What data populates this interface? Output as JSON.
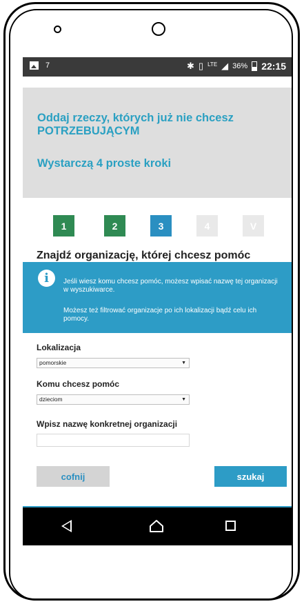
{
  "status_bar": {
    "notification_number": "7",
    "icons": [
      "image-icon",
      "bluetooth-icon",
      "vibrate-icon",
      "lte-icon",
      "signal-icon",
      "battery-icon"
    ],
    "lte_label": "LTE",
    "battery": "36%",
    "time": "22:15"
  },
  "hero": {
    "title": "Oddaj rzeczy, których już nie chcesz POTRZEBUJĄCYM",
    "subtitle": "Wystarczą 4 proste kroki"
  },
  "steps": [
    {
      "label": "1",
      "state": "done"
    },
    {
      "label": "2",
      "state": "done"
    },
    {
      "label": "3",
      "state": "active"
    },
    {
      "label": "4",
      "state": "pending"
    },
    {
      "label": "V",
      "state": "pending"
    }
  ],
  "section_title": "Znajdź organizację, której chcesz pomóc",
  "info_banner": {
    "paragraph1": "Jeśli wiesz komu chcesz pomóc, możesz wpisać nazwę tej organizacji w wyszukiwarce.",
    "paragraph2": "Możesz też filtrować organizacje po ich lokalizacji bądź celu ich pomocy."
  },
  "form": {
    "location_label": "Lokalizacja",
    "location_value": "pomorskie",
    "help_label": "Komu chcesz pomóc",
    "help_value": "dzieciom",
    "name_label": "Wpisz nazwę konkretnej organizacji",
    "name_value": ""
  },
  "buttons": {
    "back": "cofnij",
    "search": "szukaj"
  },
  "colors": {
    "accent": "#2d9cc6",
    "step_done": "#2f8a53",
    "hero_bg": "#dedede"
  }
}
